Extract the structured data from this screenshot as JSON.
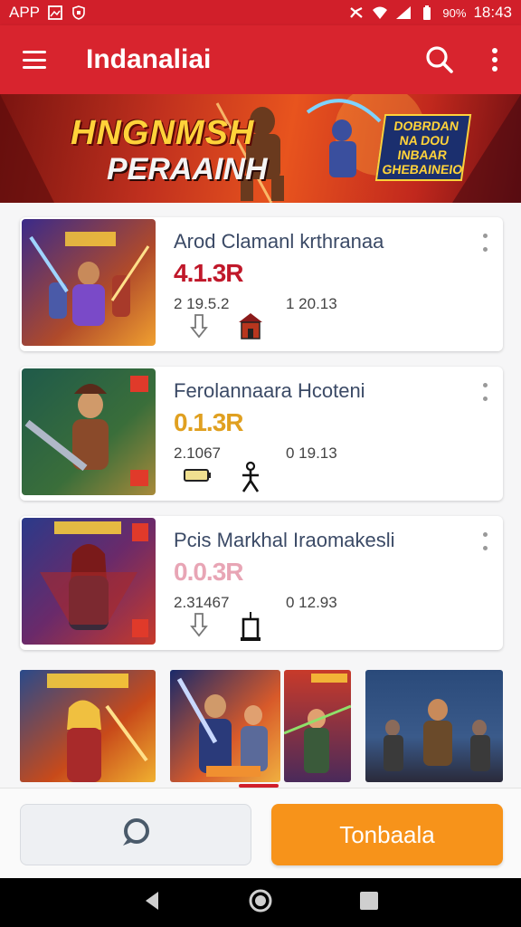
{
  "status": {
    "left_label": "APP",
    "battery": "90%",
    "time": "18:43"
  },
  "app_bar": {
    "title": "Indanaliai"
  },
  "banner": {
    "title": "HNGNMSH",
    "subtitle": "PERAAINH",
    "tag": "DOBRDAN NA DOU INBAAR GHEBAINEIO"
  },
  "cards": [
    {
      "title": "Arod Clamanl krthranaa",
      "rating": "4.1.3R",
      "rating_color": "#c0182a",
      "meta1": "2 19.5.2",
      "meta2": "1 20.13"
    },
    {
      "title": "Ferolannaara Hcoteni",
      "rating": "0.1.3R",
      "rating_color": "#e0a020",
      "meta1": "2.1067",
      "meta2": "0 19.13"
    },
    {
      "title": "Pcis Markhal Iraomakesli",
      "rating": "0.0.3R",
      "rating_color": "#e8a5b5",
      "meta1": "2.31467",
      "meta2": "0 12.93"
    }
  ],
  "gallery_count": 4,
  "bottom": {
    "primary_label": "Tonbaala"
  },
  "colors": {
    "brand": "#d8242e",
    "accent": "#f7931a"
  },
  "icons": [
    "menu-icon",
    "search-icon",
    "more-vert-icon",
    "chat-icon",
    "back-icon",
    "home-icon",
    "recents-icon"
  ]
}
